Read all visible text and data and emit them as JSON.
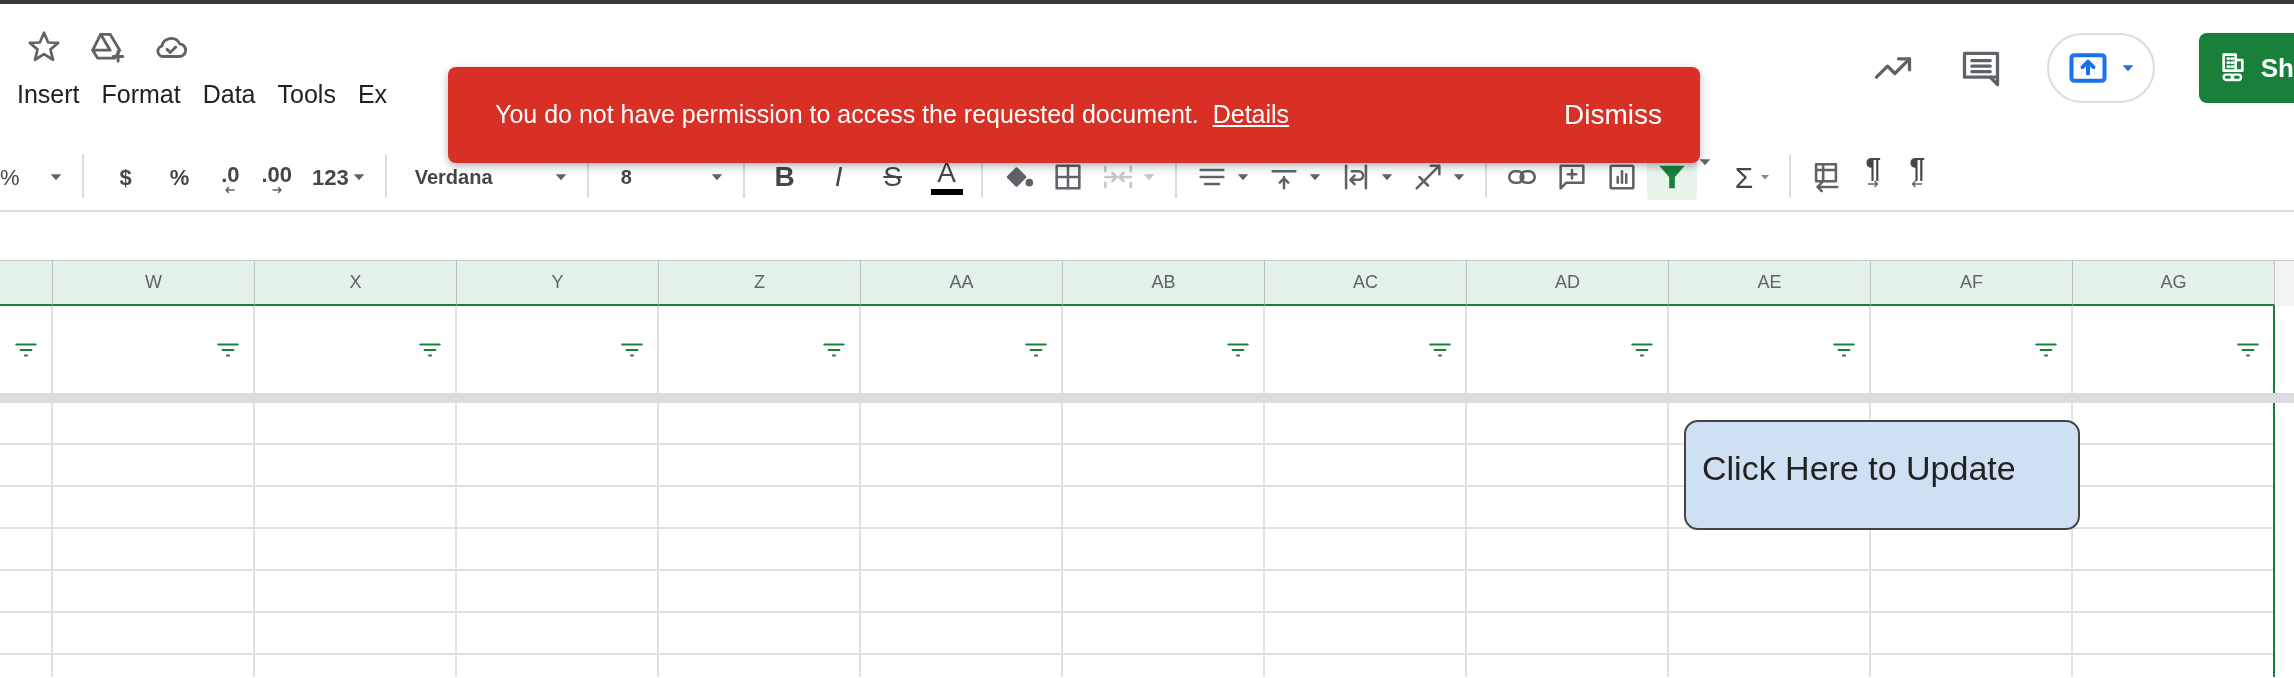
{
  "share_button": {
    "label": "Sh"
  },
  "menu": [
    "Insert",
    "Format",
    "Data",
    "Tools",
    "Ex"
  ],
  "toolbar": {
    "zoom": "%",
    "number_formats": [
      "$",
      "%",
      ".0",
      ".00",
      "123"
    ],
    "font": "Verdana",
    "font_size": "8",
    "text_styles": [
      "B",
      "I",
      "S",
      "A"
    ],
    "function_button": "Σ",
    "direction_buttons": [
      "¶",
      "¶"
    ],
    "filter": {
      "selected": true
    }
  },
  "columns": [
    "W",
    "X",
    "Y",
    "Z",
    "AA",
    "AB",
    "AC",
    "AD",
    "AE",
    "AF",
    "AG"
  ],
  "update_button": {
    "label": "Click Here to Update"
  },
  "toast": {
    "message": "You do not have permission to access the requested document.",
    "link": "Details",
    "action": "Dismiss"
  }
}
